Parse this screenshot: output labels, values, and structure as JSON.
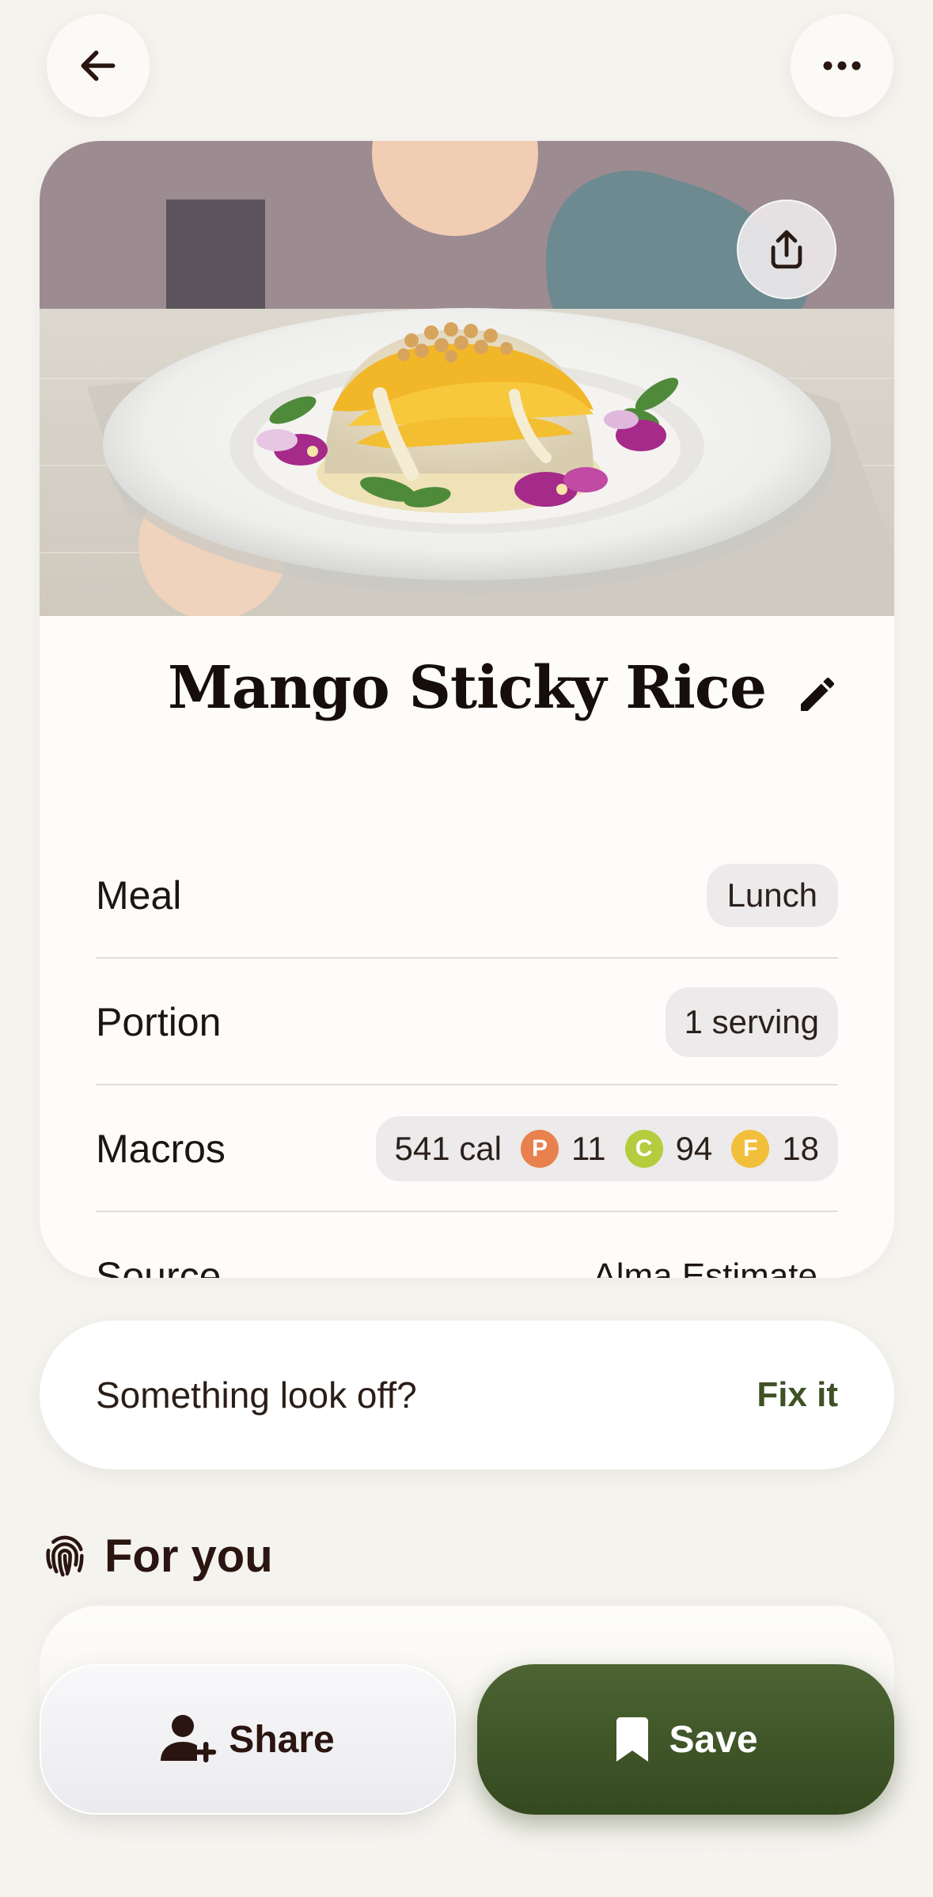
{
  "recipe": {
    "title": "Mango Sticky Rice"
  },
  "details": {
    "meal": {
      "label": "Meal",
      "value": "Lunch"
    },
    "portion": {
      "label": "Portion",
      "value": "1 serving"
    },
    "macros": {
      "label": "Macros",
      "calories": "541 cal",
      "protein": {
        "letter": "P",
        "value": "11",
        "color": "#e8814e"
      },
      "carbs": {
        "letter": "C",
        "value": "94",
        "color": "#b5cc3e"
      },
      "fat": {
        "letter": "F",
        "value": "18",
        "color": "#f2bf3a"
      }
    },
    "source": {
      "label": "Source",
      "value": "Alma Estimate"
    }
  },
  "feedback": {
    "prompt": "Something look off?",
    "action": "Fix it"
  },
  "for_you": {
    "title": "For you"
  },
  "actions": {
    "share_label": "Share",
    "save_label": "Save"
  },
  "icons": {
    "back": "arrow-left-icon",
    "more": "ellipsis-icon",
    "share_out": "share-upload-icon",
    "edit": "pencil-icon",
    "for_you": "fingerprint-icon",
    "share_person": "person-add-icon",
    "save": "bookmark-icon"
  },
  "colors": {
    "background": "#f5f3ee",
    "card": "#fdfcfa",
    "accent_green": "#3f5226",
    "save_button": "#3d5428",
    "text_dark": "#2a1510"
  }
}
